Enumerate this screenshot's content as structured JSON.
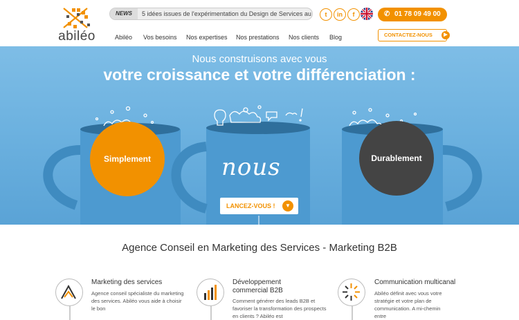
{
  "brand": {
    "logo_text": "abiléo",
    "accent": "#f29100",
    "dark": "#444444",
    "hero_bg": "#6db2e0"
  },
  "news": {
    "tag": "NEWS",
    "text": "5 idées issues de l'expérimentation du Design de Services au"
  },
  "social": [
    {
      "name": "twitter-icon",
      "glyph": "t"
    },
    {
      "name": "linkedin-icon",
      "glyph": "in"
    },
    {
      "name": "facebook-icon",
      "glyph": "f"
    }
  ],
  "phone": {
    "label": "01 78 09 49 00",
    "icon": "phone-icon"
  },
  "nav": [
    {
      "key": "abileo",
      "label": "Abiléo"
    },
    {
      "key": "besoins",
      "label": "Vos besoins"
    },
    {
      "key": "expertises",
      "label": "Nos expertises"
    },
    {
      "key": "prestations",
      "label": "Nos prestations"
    },
    {
      "key": "clients",
      "label": "Nos clients"
    },
    {
      "key": "blog",
      "label": "Blog"
    }
  ],
  "contact": {
    "label": "CONTACTEZ-NOUS"
  },
  "hero": {
    "line1": "Nous construisons avec vous",
    "line2": "votre croissance et votre différenciation :",
    "left_circle": "Simplement",
    "center_word": "nous",
    "right_circle": "Durablement",
    "cta": "LANCEZ-VOUS !"
  },
  "main": {
    "title": "Agence Conseil en Marketing des Services - Marketing B2B",
    "services": [
      {
        "title": "Marketing des services",
        "text": "Agence conseil spécialiste du marketing des services. Abiléo vous aide à choisir le bon",
        "icon": "marketing-icon"
      },
      {
        "title": "Développement commercial B2B",
        "text": "Comment générer des leads B2B et favoriser la transformation des prospects en clients ? Abiléo est",
        "icon": "bar-chart-icon"
      },
      {
        "title": "Communication multicanal",
        "text": "Abiléo définit avec vous votre stratégie et votre plan de communication. A mi-chemin entre",
        "icon": "burst-icon"
      }
    ]
  }
}
